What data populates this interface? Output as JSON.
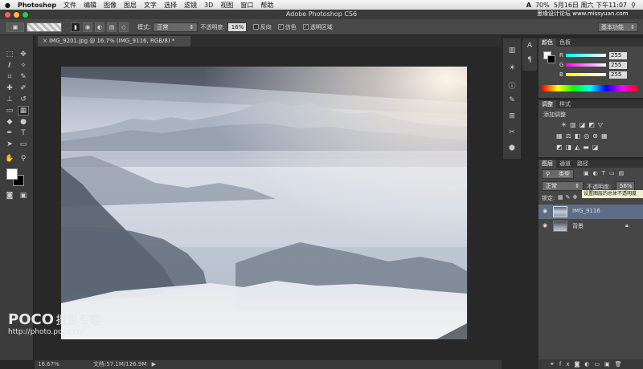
{
  "menubar": {
    "apple": "",
    "app": "Photoshop",
    "items": [
      "文件",
      "编辑",
      "图像",
      "图层",
      "文字",
      "选择",
      "滤镜",
      "3D",
      "视图",
      "窗口",
      "帮助"
    ],
    "battery": "70%",
    "datetime": "5月16日 周六 下午11:07"
  },
  "window": {
    "title": "Adobe Photoshop CS6"
  },
  "options": {
    "mode_label": "模式:",
    "mode_value": "正常",
    "opacity_label": "不透明度:",
    "opacity_value": "16%",
    "reverse_label": "反向",
    "dither_label": "仿色",
    "transparency_label": "透明区域",
    "workspace": "基本功能"
  },
  "document": {
    "tab": "IMG_9201.jpg @ 16.7% (IMG_9116, RGB/8) *",
    "zoom": "16.67%",
    "doc_size": "文档:57.1M/126.9M"
  },
  "color_panel": {
    "tabs": [
      "颜色",
      "色板"
    ],
    "r_label": "R",
    "r_value": "255",
    "g_label": "G",
    "g_value": "255",
    "b_label": "B",
    "b_value": "255"
  },
  "adjust_panel": {
    "tabs": [
      "调整",
      "样式"
    ],
    "title": "添加调整"
  },
  "layers_panel": {
    "tabs": [
      "图层",
      "通道",
      "路径"
    ],
    "kind": "类型",
    "blend": "正常",
    "opacity_label": "不透明度:",
    "opacity_value": "56%",
    "lock_label": "锁定:",
    "tooltip": "设置图层的总体不透明度",
    "layers": [
      {
        "name": "IMG_9116"
      },
      {
        "name": "背景"
      }
    ]
  },
  "watermark": {
    "brand": "POCO",
    "cn": "摄影专题",
    "url": "http://photo.poco.cn/",
    "site": "思缘设计论坛 www.missyuan.com"
  }
}
